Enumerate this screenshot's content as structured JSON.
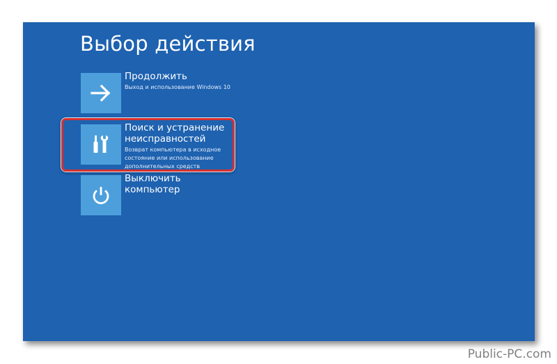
{
  "screen": {
    "title": "Выбор действия",
    "background": "#1e62b0",
    "tile_color": "#4d9fdc"
  },
  "options": [
    {
      "title": "Продолжить",
      "description": "Выход и использование Windows 10",
      "icon": "arrow-right-icon"
    },
    {
      "title": "Поиск и устранение неисправностей",
      "description": "Возврат компьютера в исходное состояние или использование дополнительных средств",
      "icon": "tools-icon",
      "highlighted": true,
      "highlight_color": "#d8302f"
    },
    {
      "title": "Выключить компьютер",
      "description": "",
      "icon": "power-icon"
    }
  ],
  "watermark": "Public-PC.com"
}
